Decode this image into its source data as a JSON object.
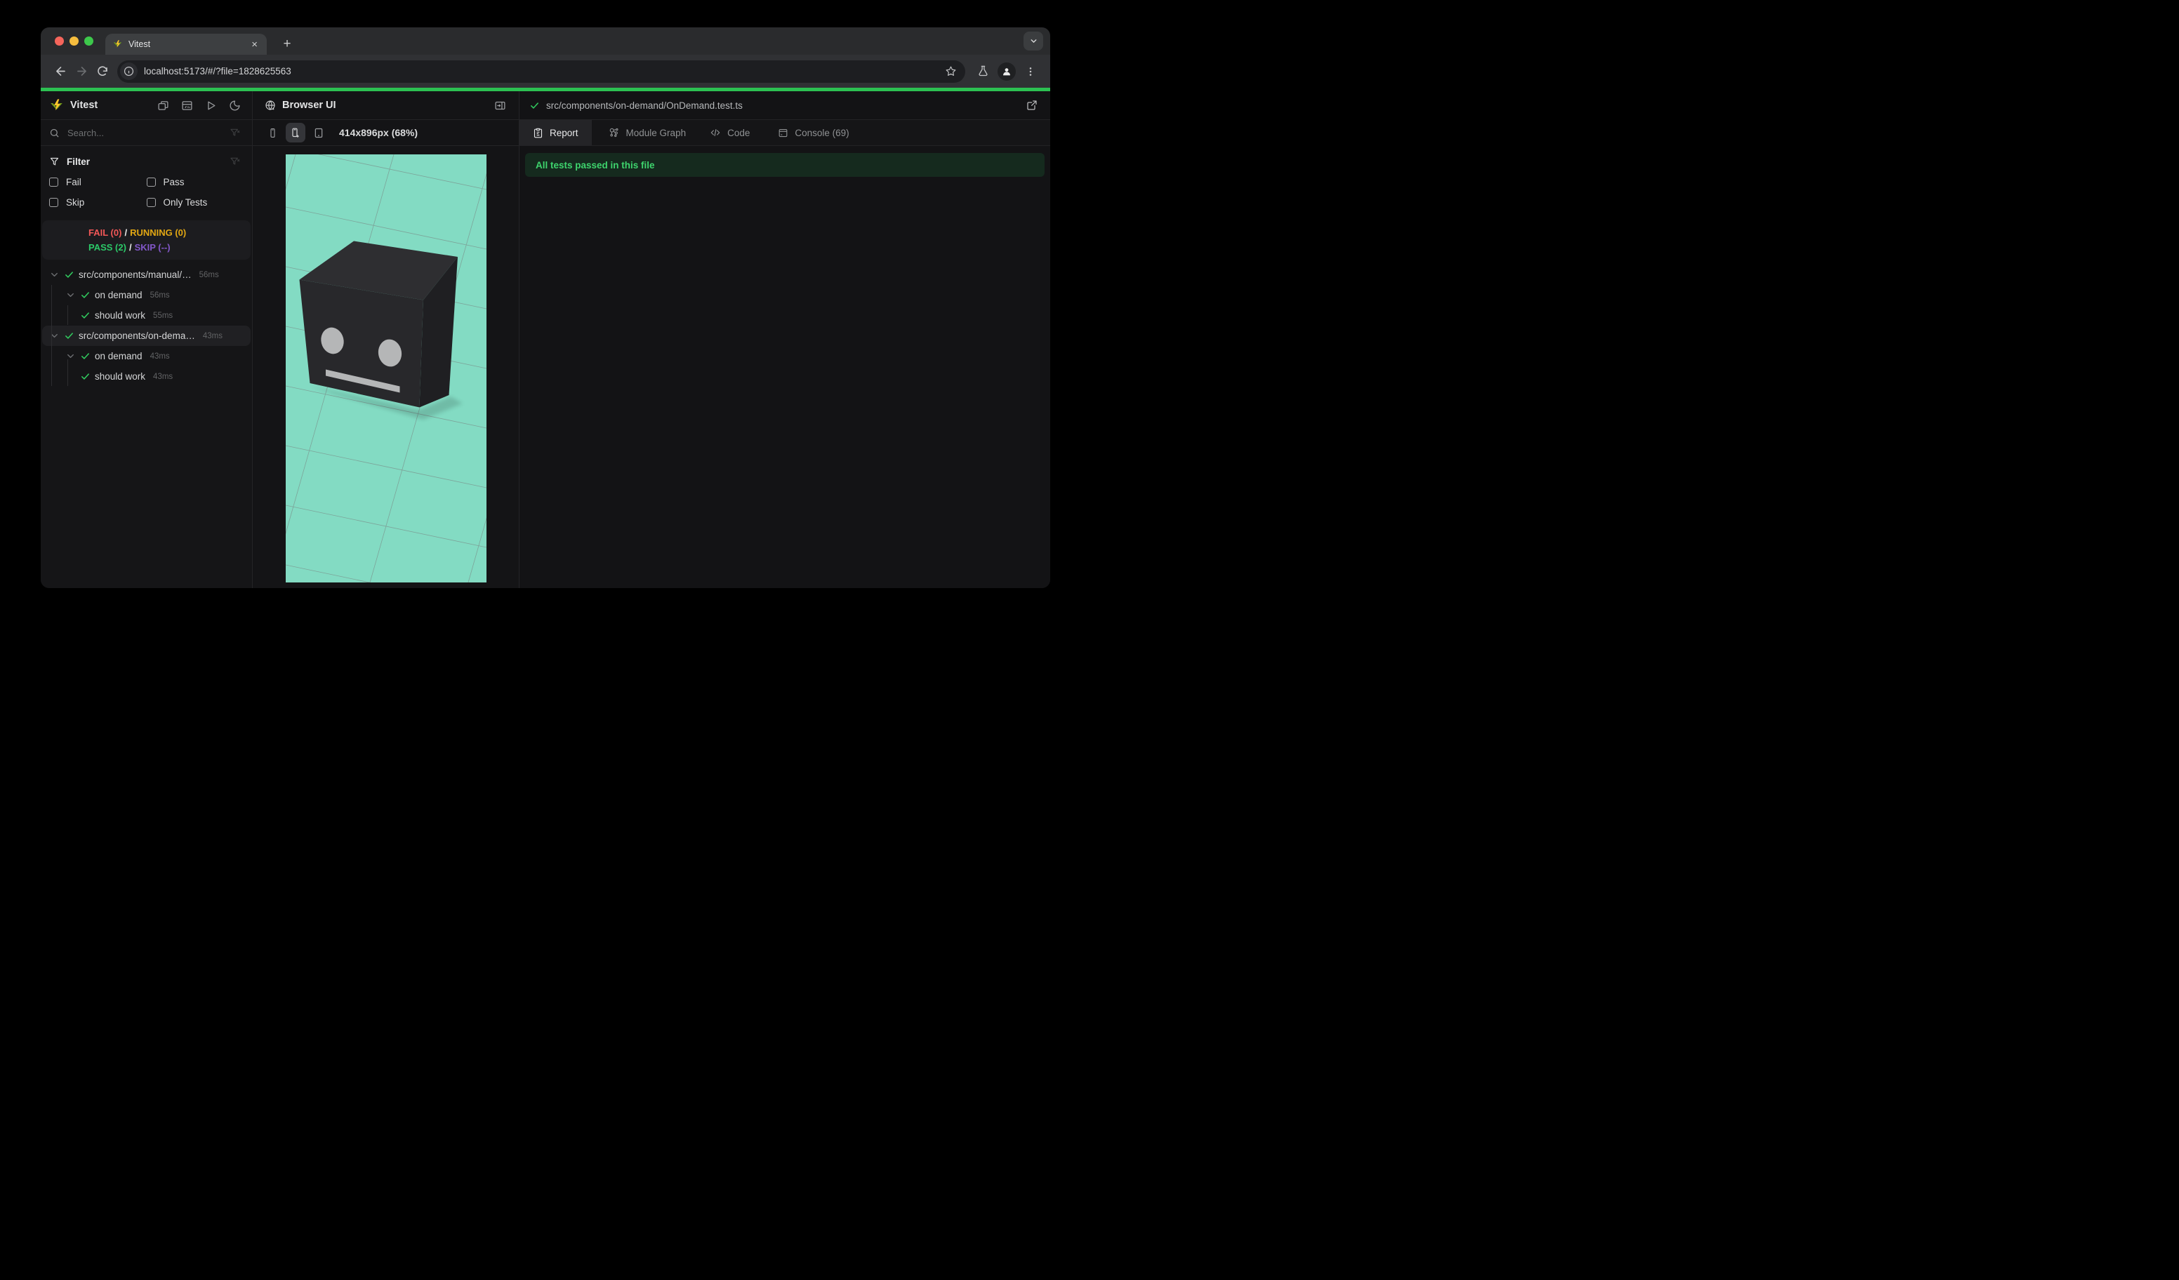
{
  "browser": {
    "tab_title": "Vitest",
    "tab_close_label": "×",
    "new_tab_label": "+",
    "url": "localhost:5173/#/?file=1828625563",
    "traffic_lights": {
      "close": "#f5655b",
      "minimize": "#f6bd3e",
      "zoom": "#3dc84b"
    }
  },
  "progress": {
    "color": "#2cc152"
  },
  "sidebar": {
    "brand": "Vitest",
    "search_placeholder": "Search...",
    "filter_title": "Filter",
    "checkboxes": [
      {
        "label": "Fail",
        "checked": false
      },
      {
        "label": "Pass",
        "checked": false
      },
      {
        "label": "Skip",
        "checked": false
      },
      {
        "label": "Only Tests",
        "checked": false
      }
    ],
    "stats": {
      "fail": "FAIL (0)",
      "sep1": "/",
      "running": "RUNNING (0)",
      "pass": "PASS (2)",
      "sep2": "/",
      "skip": "SKIP (--)",
      "colors": {
        "fail": "#f25757",
        "running": "#e2a713",
        "pass": "#2bc968",
        "skip": "#8257c9"
      }
    },
    "tree": [
      {
        "label": "src/components/manual/…",
        "duration": "56ms",
        "depth": 0,
        "status": "pass"
      },
      {
        "label": "on demand",
        "duration": "56ms",
        "depth": 1,
        "status": "pass"
      },
      {
        "label": "should work",
        "duration": "55ms",
        "depth": 2,
        "status": "pass"
      },
      {
        "label": "src/components/on-dema…",
        "duration": "43ms",
        "depth": 0,
        "status": "pass",
        "selected": true
      },
      {
        "label": "on demand",
        "duration": "43ms",
        "depth": 1,
        "status": "pass"
      },
      {
        "label": "should work",
        "duration": "43ms",
        "depth": 2,
        "status": "pass"
      }
    ]
  },
  "preview": {
    "title": "Browser UI",
    "dimensions_label": "414x896px (68%)",
    "viewport_bg": "#83dbc3",
    "scene": {
      "cube_front": "#28282b",
      "cube_top": "#2e2e31",
      "cube_right": "#1f1f22",
      "face_features": "#b5b6b7",
      "grid_line": "#777777"
    }
  },
  "report": {
    "file_path": "src/components/on-demand/OnDemand.test.ts",
    "tabs": [
      {
        "label": "Report",
        "active": true
      },
      {
        "label": "Module Graph",
        "active": false
      },
      {
        "label": "Code",
        "active": false
      },
      {
        "label": "Console (69)",
        "active": false
      }
    ],
    "banner_text": "All tests passed in this file",
    "banner_bg": "#152a1e",
    "banner_color": "#3ed46d"
  }
}
